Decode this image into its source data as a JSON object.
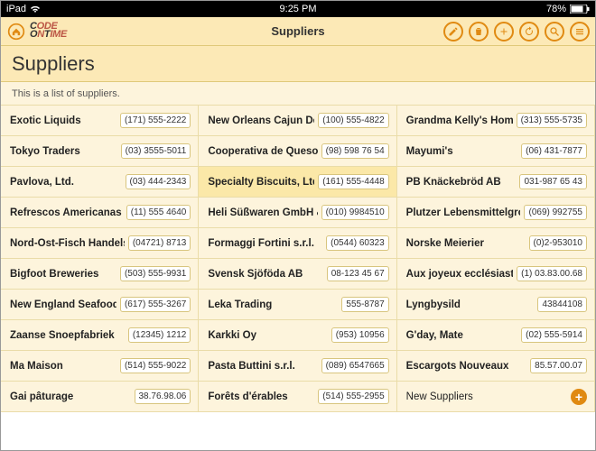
{
  "statusbar": {
    "carrier": "iPad",
    "time": "9:25 PM",
    "battery": "78%"
  },
  "appbar": {
    "title": "Suppliers",
    "logo_top": "CODE",
    "logo_bottom": "ONTIME"
  },
  "page": {
    "title": "Suppliers",
    "description": "This is a list of suppliers."
  },
  "new_row_label": "New Suppliers",
  "suppliers": [
    {
      "name": "Exotic Liquids",
      "phone": "(171) 555-2222"
    },
    {
      "name": "New Orleans Cajun Delights",
      "phone": "(100) 555-4822"
    },
    {
      "name": "Grandma Kelly's Homestead",
      "phone": "(313) 555-5735"
    },
    {
      "name": "Tokyo Traders",
      "phone": "(03) 3555-5011"
    },
    {
      "name": "Cooperativa de Quesos 'Las",
      "phone": "(98) 598 76 54"
    },
    {
      "name": "Mayumi's",
      "phone": "(06) 431-7877"
    },
    {
      "name": "Pavlova, Ltd.",
      "phone": "(03) 444-2343"
    },
    {
      "name": "Specialty Biscuits, Ltd.",
      "phone": "(161) 555-4448",
      "selected": true
    },
    {
      "name": "PB Knäckebröd AB",
      "phone": "031-987 65 43"
    },
    {
      "name": "Refrescos Americanas LTDA",
      "phone": "(11) 555 4640"
    },
    {
      "name": "Heli Süßwaren GmbH & Co.",
      "phone": "(010) 9984510"
    },
    {
      "name": "Plutzer Lebensmittelgroßmär",
      "phone": "(069) 992755"
    },
    {
      "name": "Nord-Ost-Fisch Handelsgesel",
      "phone": "(04721) 8713"
    },
    {
      "name": "Formaggi Fortini s.r.l.",
      "phone": "(0544) 60323"
    },
    {
      "name": "Norske Meierier",
      "phone": "(0)2-953010"
    },
    {
      "name": "Bigfoot Breweries",
      "phone": "(503) 555-9931"
    },
    {
      "name": "Svensk Sjöföda AB",
      "phone": "08-123 45 67"
    },
    {
      "name": "Aux joyeux ecclésiastiques",
      "phone": "(1) 03.83.00.68"
    },
    {
      "name": "New England Seafood Cann",
      "phone": "(617) 555-3267"
    },
    {
      "name": "Leka Trading",
      "phone": "555-8787"
    },
    {
      "name": "Lyngbysild",
      "phone": "43844108"
    },
    {
      "name": "Zaanse Snoepfabriek",
      "phone": "(12345) 1212"
    },
    {
      "name": "Karkki Oy",
      "phone": "(953) 10956"
    },
    {
      "name": "G'day, Mate",
      "phone": "(02) 555-5914"
    },
    {
      "name": "Ma Maison",
      "phone": "(514) 555-9022"
    },
    {
      "name": "Pasta Buttini s.r.l.",
      "phone": "(089) 6547665"
    },
    {
      "name": "Escargots Nouveaux",
      "phone": "85.57.00.07"
    },
    {
      "name": "Gai pâturage",
      "phone": "38.76.98.06"
    },
    {
      "name": "Forêts d'érables",
      "phone": "(514) 555-2955"
    }
  ]
}
